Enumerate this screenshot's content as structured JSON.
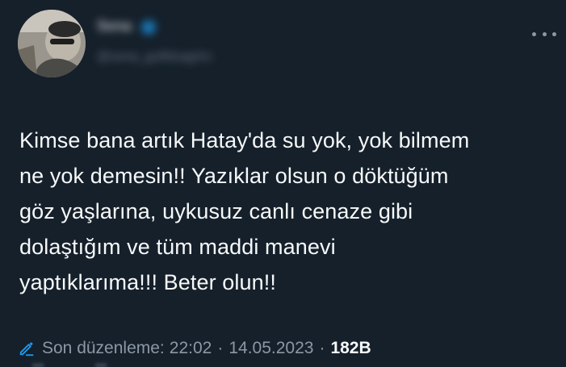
{
  "author": {
    "display_name": "Sena",
    "handle": "@sena_gulfdsagrtrc"
  },
  "tweet": {
    "lines": [
      "Kimse bana artık Hatay'da su yok, yok bilmem",
      "ne yok demesin!! Yazıklar olsun o döktüğüm",
      "göz yaşlarına, uykusuz canlı cenaze gibi",
      "dolaştığım ve tüm maddi manevi",
      "yaptıklarıma!!! Beter olun!!"
    ]
  },
  "meta": {
    "edited_label": "Son düzenleme:",
    "time": "22:02",
    "separator": "·",
    "date": "14.05.2023",
    "views": "182B"
  },
  "icons": {
    "more": "more-horizontal-icon",
    "edit": "pencil-edit-icon",
    "verified": "verified-badge-icon"
  },
  "colors": {
    "background": "#15202b",
    "text": "#f7f9f9",
    "muted": "#8b98a5",
    "accent": "#1d9bf0"
  }
}
